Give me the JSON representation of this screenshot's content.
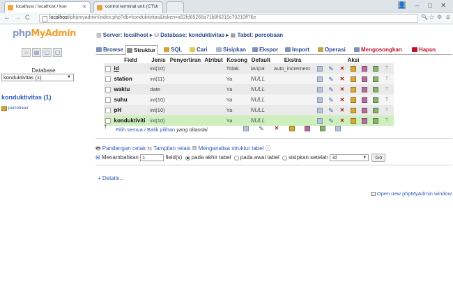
{
  "browser": {
    "tabs": [
      {
        "title": "localhost / localhost / kon"
      },
      {
        "title": "control terminal unit (CTU"
      }
    ],
    "url_host": "localhost",
    "url_path": "/phpmyadmin/index.php?db=konduktivitas&token=a52fd89266a71b8f6215c79210ff76e"
  },
  "sidebar": {
    "logo_php": "php",
    "logo_myadmin": "MyAdmin",
    "db_label": "Database",
    "db_select": "konduktivitas (1)",
    "db_title": "konduktivitas (1)",
    "table_link": "percobaan"
  },
  "breadcrumb": {
    "server": "Server: localhost",
    "database": "Database: konduktivitas",
    "table": "Tabel: percobaan"
  },
  "tabs": [
    {
      "label": "Browse"
    },
    {
      "label": "Struktur"
    },
    {
      "label": "SQL"
    },
    {
      "label": "Cari"
    },
    {
      "label": "Sisipkan"
    },
    {
      "label": "Ekspor"
    },
    {
      "label": "Import"
    },
    {
      "label": "Operasi"
    },
    {
      "label": "Mengosongkan"
    },
    {
      "label": "Hapus"
    }
  ],
  "table": {
    "headers": [
      "Field",
      "Jenis",
      "Penyortiran",
      "Atribut",
      "Kosong",
      "Default",
      "Ekstra",
      "Aksi"
    ],
    "rows": [
      {
        "field": "id",
        "type": "int(10)",
        "collation": "",
        "attr": "",
        "null": "Tidak",
        "default": "tanpa",
        "extra": "auto_increment"
      },
      {
        "field": "station",
        "type": "int(11)",
        "collation": "",
        "attr": "",
        "null": "Ya",
        "default": "NULL",
        "extra": ""
      },
      {
        "field": "waktu",
        "type": "date",
        "collation": "",
        "attr": "",
        "null": "Ya",
        "default": "NULL",
        "extra": ""
      },
      {
        "field": "suhu",
        "type": "int(10)",
        "collation": "",
        "attr": "",
        "null": "Ya",
        "default": "NULL",
        "extra": ""
      },
      {
        "field": "pH",
        "type": "int(10)",
        "collation": "",
        "attr": "",
        "null": "Ya",
        "default": "NULL",
        "extra": ""
      },
      {
        "field": "konduktiviti",
        "type": "int(10)",
        "collation": "",
        "attr": "",
        "null": "Ya",
        "default": "NULL",
        "extra": ""
      }
    ]
  },
  "bulk": {
    "select_all": "Pilih semua / Balik pilihan",
    "with_selected": "yang ditandai"
  },
  "links": {
    "print_view": "Pandangan cetak",
    "relation_view": "Tampilan relasi",
    "analyze": "Menganalisa struktur tabel"
  },
  "add_field": {
    "add_label": "Menambahkan",
    "count": "1",
    "fields_label": "field(s)",
    "at_end": "pada akhir tabel",
    "at_start": "pada awal tabel",
    "after": "sisipkan setelah",
    "after_select": "id",
    "go": "Go"
  },
  "details": "+ Details...",
  "open_window": "Open new phpMyAdmin window"
}
